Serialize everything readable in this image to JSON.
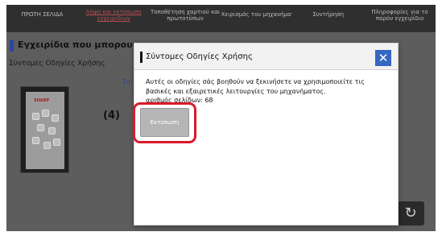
{
  "nav": {
    "items": [
      {
        "label": "ΠΡΩΤΗ ΣΕΛΙΔΑ",
        "active": false
      },
      {
        "label": "Λήψη και εκτύπωση εγχειριδίων",
        "active": true
      },
      {
        "label": "Τοποθέτηση χαρτιού και πρωτοτύπων",
        "active": false
      },
      {
        "label": "Χειρισμός του μηχανήματος",
        "active": false
      },
      {
        "label": "Συντήρηση",
        "active": false
      },
      {
        "label": "Πληροφορίες για το παρόν εγχειρίδιο",
        "active": false
      }
    ]
  },
  "page": {
    "title": "Εγχειρίδια που μπορουν να",
    "subtitle": "Σύντομες Οδηγίες Χρήσης",
    "bg_link": "Συ",
    "thumb_brand": "SHARP",
    "back_icon": "↻"
  },
  "dialog": {
    "title": "Σύντομες Οδηγίες Χρήσης",
    "description": "Αυτές οι οδηγίες σάς βοηθούν να ξεκινήσετε να χρησιμοποιείτε τις βασικές και εξαιρετικές λειτουργίες του μηχανήματος.",
    "pages": "αριθμός σελίδων: 68",
    "close": "✕",
    "print_label": "Εκτύπωση"
  },
  "annotation": {
    "step_label": "(4)"
  },
  "colors": {
    "highlight": "#d81a2a",
    "close_button": "#3567c2",
    "active_nav": "#b94f4f",
    "accent_bar": "#2b45a0"
  }
}
